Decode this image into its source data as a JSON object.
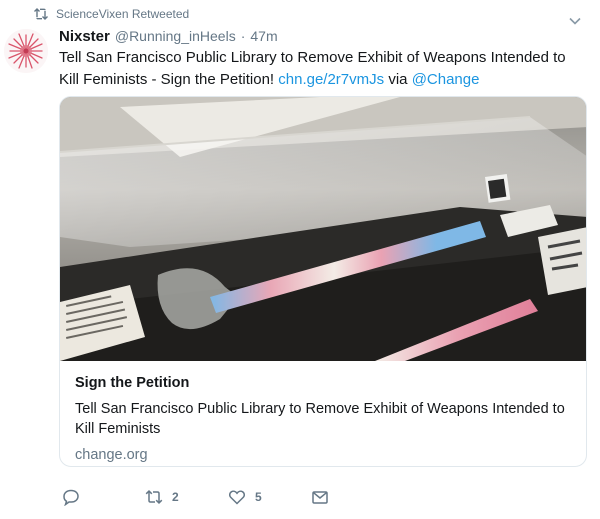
{
  "retweet": {
    "icon": "retweet-icon",
    "label": "ScienceVixen Retweeted"
  },
  "author": {
    "name": "Nixster",
    "handle": "@Running_inHeels",
    "separator": "·",
    "time": "47m"
  },
  "tweet": {
    "text": "Tell San Francisco Public Library to Remove Exhibit of Weapons Intended to Kill Feminists - Sign the Petition!",
    "link": "chn.ge/2r7vmJs",
    "via": "via",
    "mention": "@Change"
  },
  "card": {
    "title": "Sign the Petition",
    "description": "Tell San Francisco Public Library to Remove Exhibit of Weapons Intended to Kill Feminists",
    "domain": "change.org"
  },
  "actions": {
    "reply": {
      "icon": "reply-icon"
    },
    "retweet": {
      "icon": "retweet-icon",
      "count": "2"
    },
    "like": {
      "icon": "heart-icon",
      "count": "5"
    },
    "message": {
      "icon": "envelope-icon"
    }
  },
  "colors": {
    "link": "#1b95e0",
    "secondary_text": "#657786",
    "primary_text": "#14171a",
    "border": "#e1e8ed"
  }
}
